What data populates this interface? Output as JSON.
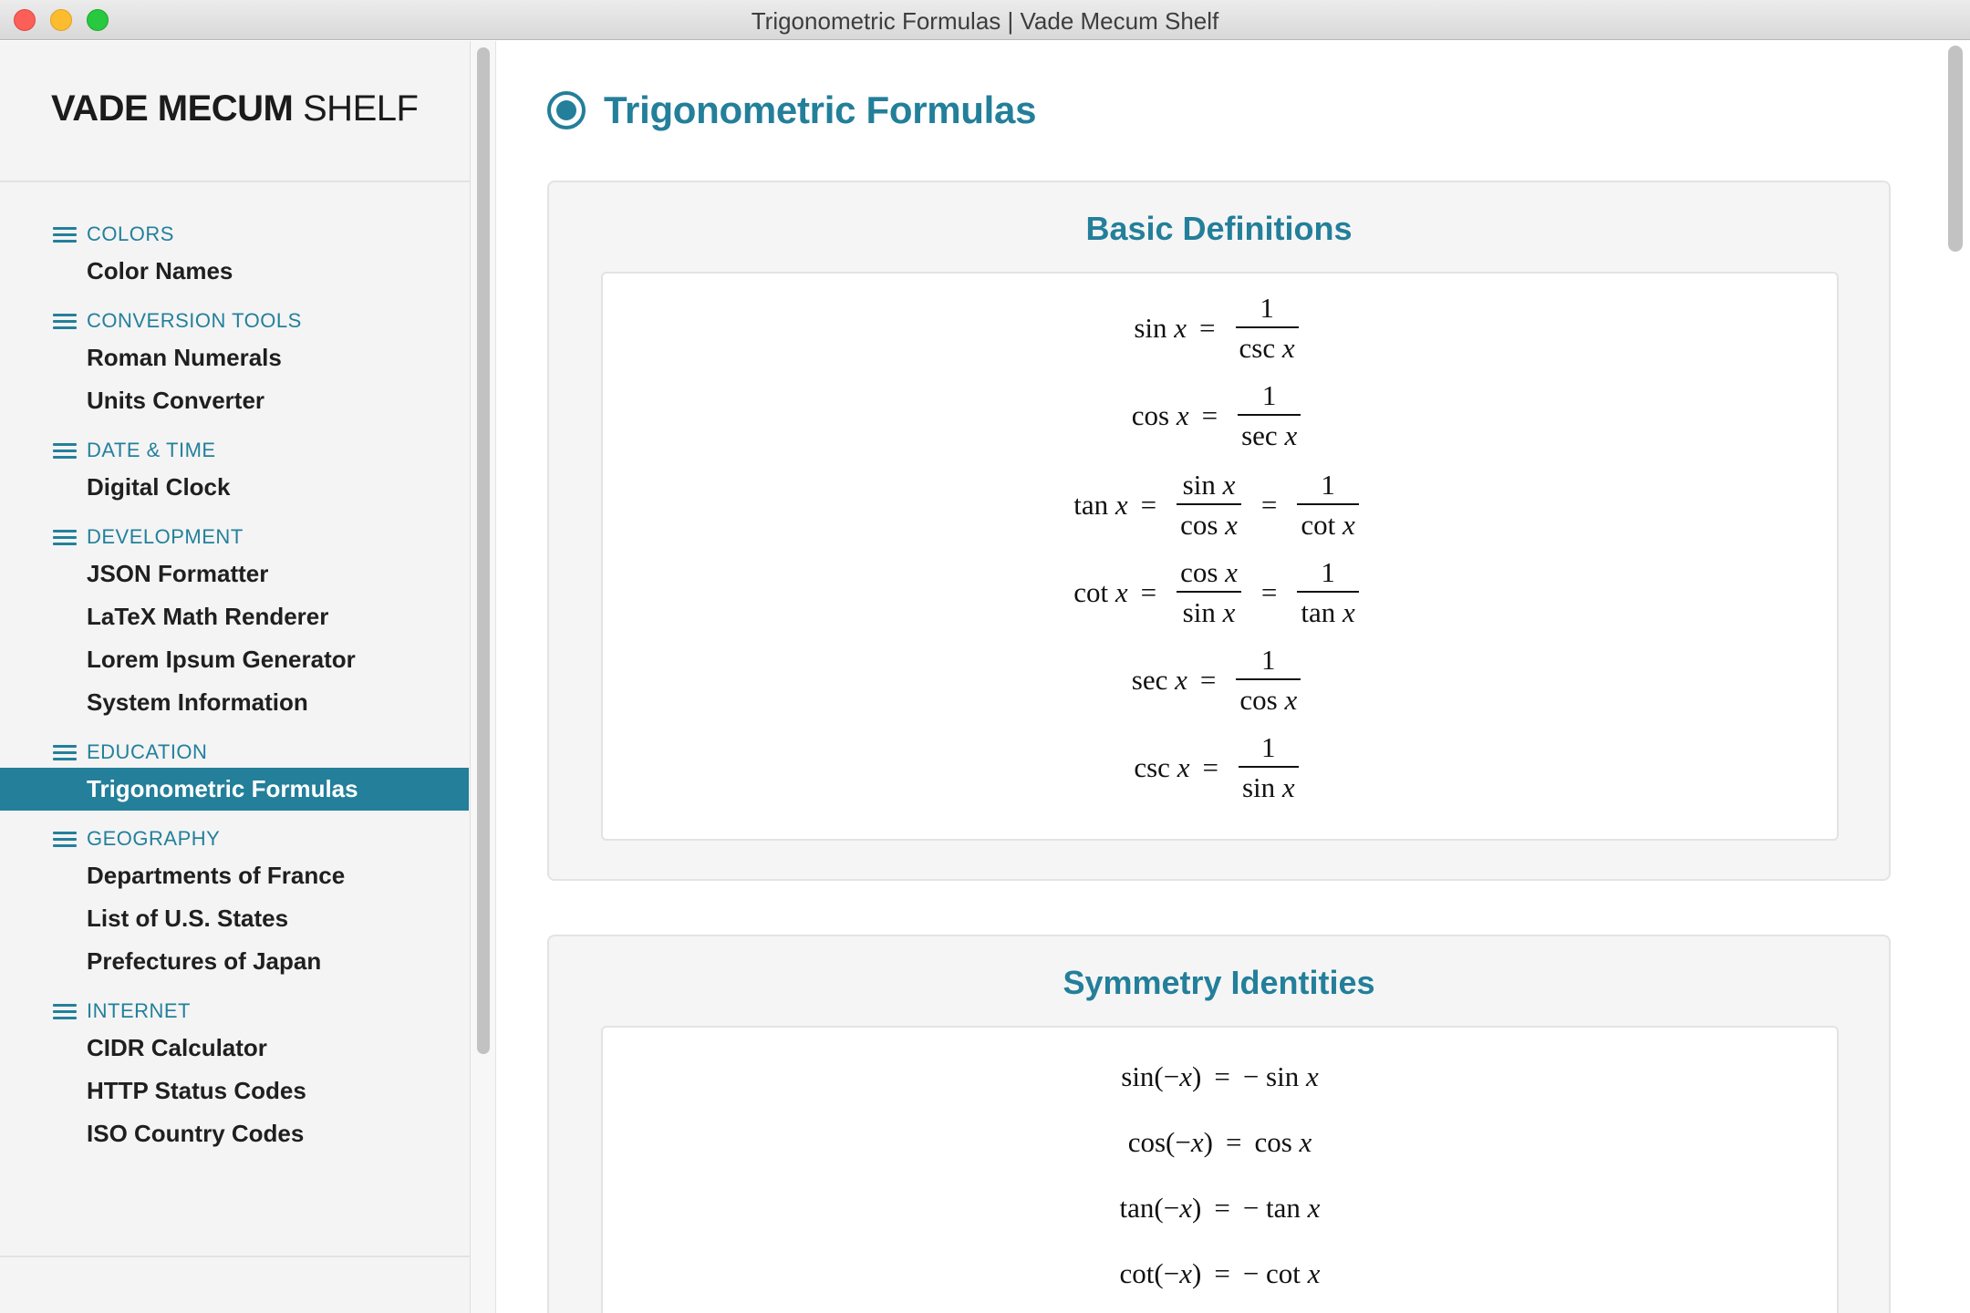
{
  "window": {
    "title": "Trigonometric Formulas | Vade Mecum Shelf"
  },
  "brand": {
    "bold": "VADE MECUM",
    "light": "SHELF"
  },
  "nav": {
    "categories": [
      {
        "label": "COLORS",
        "items": [
          "Color Names"
        ]
      },
      {
        "label": "CONVERSION TOOLS",
        "items": [
          "Roman Numerals",
          "Units Converter"
        ]
      },
      {
        "label": "DATE & TIME",
        "items": [
          "Digital Clock"
        ]
      },
      {
        "label": "DEVELOPMENT",
        "items": [
          "JSON Formatter",
          "LaTeX Math Renderer",
          "Lorem Ipsum Generator",
          "System Information"
        ]
      },
      {
        "label": "EDUCATION",
        "items": [
          "Trigonometric Formulas"
        ]
      },
      {
        "label": "GEOGRAPHY",
        "items": [
          "Departments of France",
          "List of U.S. States",
          "Prefectures of Japan"
        ]
      },
      {
        "label": "INTERNET",
        "items": [
          "CIDR Calculator",
          "HTTP Status Codes",
          "ISO Country Codes"
        ]
      }
    ],
    "active_item": "Trigonometric Formulas"
  },
  "main": {
    "page_title": "Trigonometric Formulas",
    "sections": [
      {
        "title": "Basic Definitions",
        "formulas": [
          {
            "lhs": "sin x",
            "parts": [
              {
                "num": "1",
                "den": "csc x"
              }
            ]
          },
          {
            "lhs": "cos x",
            "parts": [
              {
                "num": "1",
                "den": "sec x"
              }
            ]
          },
          {
            "lhs": "tan x",
            "parts": [
              {
                "num": "sin x",
                "den": "cos x"
              },
              {
                "num": "1",
                "den": "cot x"
              }
            ]
          },
          {
            "lhs": "cot x",
            "parts": [
              {
                "num": "cos x",
                "den": "sin x"
              },
              {
                "num": "1",
                "den": "tan x"
              }
            ]
          },
          {
            "lhs": "sec x",
            "parts": [
              {
                "num": "1",
                "den": "cos x"
              }
            ]
          },
          {
            "lhs": "csc x",
            "parts": [
              {
                "num": "1",
                "den": "sin x"
              }
            ]
          }
        ]
      },
      {
        "title": "Symmetry Identities",
        "formulas": [
          {
            "lhs": "sin(−x)",
            "rhs": "− sin x"
          },
          {
            "lhs": "cos(−x)",
            "rhs": "cos x"
          },
          {
            "lhs": "tan(−x)",
            "rhs": "− tan x"
          },
          {
            "lhs": "cot(−x)",
            "rhs": "− cot x"
          }
        ]
      }
    ]
  },
  "colors": {
    "accent": "#237f9a",
    "sidebar_bg": "#f4f4f4",
    "section_bg": "#f5f5f5"
  }
}
